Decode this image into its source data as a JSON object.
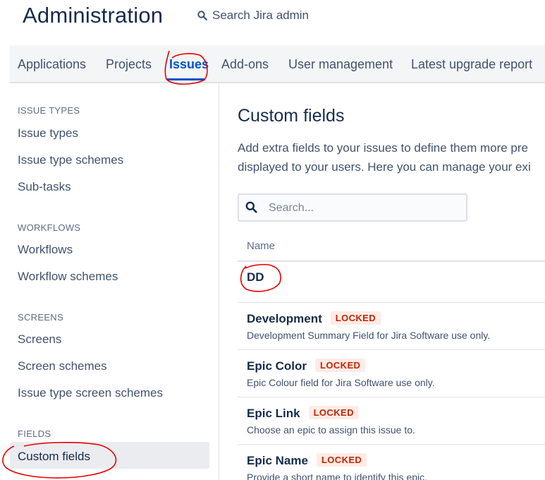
{
  "header": {
    "title": "Administration",
    "search_label": "Search Jira admin"
  },
  "tabs": [
    {
      "label": "Applications"
    },
    {
      "label": "Projects"
    },
    {
      "label": "Issues",
      "active": true
    },
    {
      "label": "Add-ons"
    },
    {
      "label": "User management"
    },
    {
      "label": "Latest upgrade report"
    }
  ],
  "sidebar": {
    "sections": [
      {
        "heading": "ISSUE TYPES",
        "items": [
          "Issue types",
          "Issue type schemes",
          "Sub-tasks"
        ]
      },
      {
        "heading": "WORKFLOWS",
        "items": [
          "Workflows",
          "Workflow schemes"
        ]
      },
      {
        "heading": "SCREENS",
        "items": [
          "Screens",
          "Screen schemes",
          "Issue type screen schemes"
        ]
      },
      {
        "heading": "FIELDS",
        "items": [
          "Custom fields"
        ]
      }
    ],
    "selected": "Custom fields"
  },
  "main": {
    "title": "Custom fields",
    "description_line1": "Add extra fields to your issues to define them more pre",
    "description_line2": "displayed to your users. Here you can manage your exi",
    "search_placeholder": "Search...",
    "column_name": "Name",
    "fields": [
      {
        "name": "DD",
        "locked": false,
        "description": ""
      },
      {
        "name": "Development",
        "locked": true,
        "description": "Development Summary Field for Jira Software use only."
      },
      {
        "name": "Epic Color",
        "locked": true,
        "description": "Epic Colour field for Jira Software use only."
      },
      {
        "name": "Epic Link",
        "locked": true,
        "description": "Choose an epic to assign this issue to."
      },
      {
        "name": "Epic Name",
        "locked": true,
        "description": "Provide a short name to identify this epic."
      }
    ],
    "locked_label": "LOCKED"
  },
  "colors": {
    "text_primary": "#172b4d",
    "text_secondary": "#42526e",
    "link_active": "#0052cc",
    "locked_bg": "#ffebe6",
    "locked_text": "#bf2600",
    "annotation_red": "#e60000"
  },
  "icons": [
    "search-icon"
  ]
}
